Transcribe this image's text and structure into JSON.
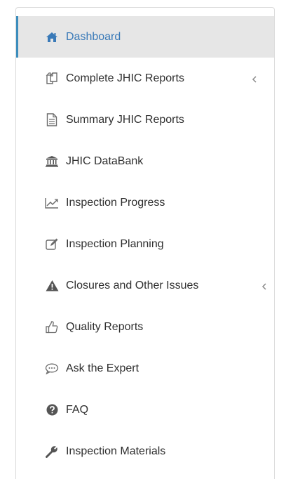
{
  "sidebar": {
    "items": [
      {
        "label": "Dashboard",
        "icon": "home-icon",
        "active": true
      },
      {
        "label": "Complete JHIC Reports",
        "icon": "copy-icon",
        "expandable": true
      },
      {
        "label": "Summary JHIC Reports",
        "icon": "document-icon"
      },
      {
        "label": "JHIC DataBank",
        "icon": "bank-icon"
      },
      {
        "label": "Inspection Progress",
        "icon": "line-chart-icon"
      },
      {
        "label": "Inspection Planning",
        "icon": "edit-icon"
      },
      {
        "label": "Closures and Other Issues",
        "icon": "warning-icon",
        "expandable": true
      },
      {
        "label": "Quality Reports",
        "icon": "thumbs-up-icon"
      },
      {
        "label": "Ask the Expert",
        "icon": "speech-bubble-icon"
      },
      {
        "label": "FAQ",
        "icon": "question-circle-icon"
      },
      {
        "label": "Inspection Materials",
        "icon": "wrench-icon"
      }
    ]
  },
  "colors": {
    "active_text": "#3a7ab8",
    "active_bg": "#e6e6e6",
    "active_border": "#3c8dbc",
    "text": "#2f2f2f",
    "icon": "#6b6b6b"
  }
}
